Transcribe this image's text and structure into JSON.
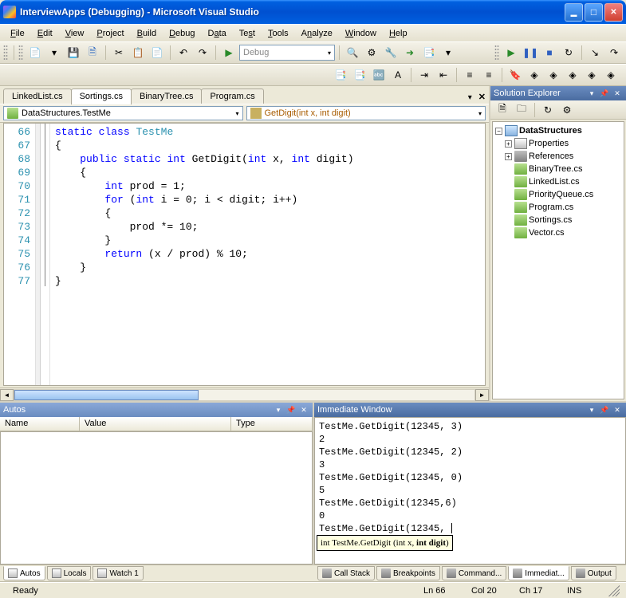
{
  "window": {
    "title": "InterviewApps (Debugging) - Microsoft Visual Studio"
  },
  "menu": {
    "file": "File",
    "edit": "Edit",
    "view": "View",
    "project": "Project",
    "build": "Build",
    "debug": "Debug",
    "data": "Data",
    "test": "Test",
    "tools": "Tools",
    "analyze": "Analyze",
    "window": "Window",
    "help": "Help"
  },
  "toolbar": {
    "config": "Debug"
  },
  "tabs": {
    "t1": "LinkedList.cs",
    "t2": "Sortings.cs",
    "t3": "BinaryTree.cs",
    "t4": "Program.cs"
  },
  "nav": {
    "class_label": "DataStructures.TestMe",
    "method_label": "GetDigit(int x, int digit)"
  },
  "code": {
    "lines": {
      "66": "static class TestMe",
      "67": "{",
      "68": "    public static int GetDigit(int x, int digit)",
      "69": "    {",
      "70": "        int prod = 1;",
      "71": "        for (int i = 0; i < digit; i++)",
      "72": "        {",
      "73": "            prod *= 10;",
      "74": "        }",
      "75": "        return (x / prod) % 10;",
      "76": "    }",
      "77": "}"
    },
    "line_numbers": [
      "66",
      "67",
      "68",
      "69",
      "70",
      "71",
      "72",
      "73",
      "74",
      "75",
      "76",
      "77"
    ]
  },
  "solution_explorer": {
    "title": "Solution Explorer",
    "root": "DataStructures",
    "properties": "Properties",
    "references": "References",
    "files": [
      "BinaryTree.cs",
      "LinkedList.cs",
      "PriorityQueue.cs",
      "Program.cs",
      "Sortings.cs",
      "Vector.cs"
    ]
  },
  "autos": {
    "title": "Autos",
    "cols": {
      "name": "Name",
      "value": "Value",
      "type": "Type"
    }
  },
  "immediate": {
    "title": "Immediate Window",
    "lines": [
      "TestMe.GetDigit(12345, 3)",
      "2",
      "TestMe.GetDigit(12345, 2)",
      "3",
      "TestMe.GetDigit(12345, 0)",
      "5",
      "TestMe.GetDigit(12345,6)",
      "0",
      "TestMe.GetDigit(12345, "
    ],
    "hint_prefix": "int TestMe.GetDigit (int x, ",
    "hint_bold": "int digit",
    "hint_suffix": ")"
  },
  "bottom_tabs_left": {
    "autos": "Autos",
    "locals": "Locals",
    "watch": "Watch 1"
  },
  "bottom_tabs_right": {
    "callstack": "Call Stack",
    "breakpoints": "Breakpoints",
    "command": "Command...",
    "immediate": "Immediat...",
    "output": "Output"
  },
  "status": {
    "ready": "Ready",
    "ln": "Ln 66",
    "col": "Col 20",
    "ch": "Ch 17",
    "ins": "INS"
  }
}
